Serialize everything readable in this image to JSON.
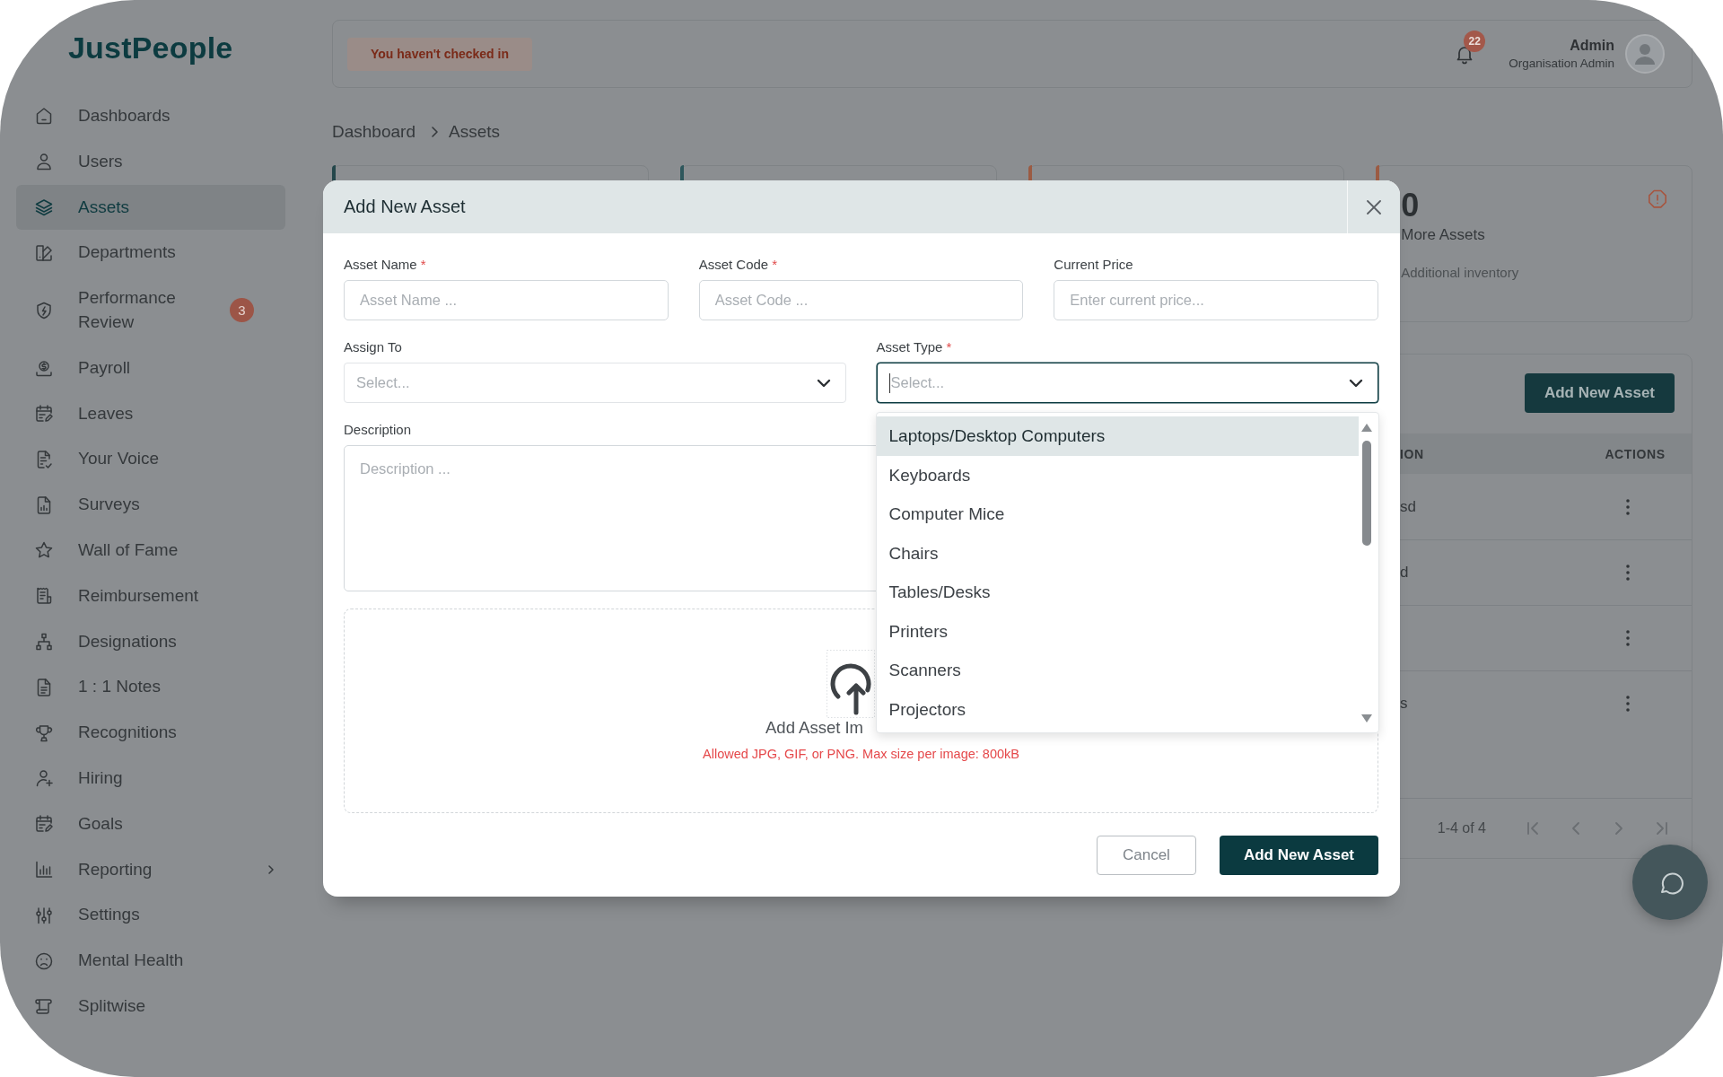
{
  "sidebar": {
    "logo": "JustPeople",
    "items": [
      {
        "label": "Dashboards",
        "kind": "link",
        "selected": false
      },
      {
        "label": "Users",
        "kind": "link",
        "selected": false
      },
      {
        "label": "Assets",
        "kind": "link",
        "selected": true
      },
      {
        "label": "Departments",
        "kind": "link",
        "selected": false
      },
      {
        "label": "Performance Review",
        "kind": "link",
        "selected": false,
        "badge": "3"
      },
      {
        "label": "Payroll",
        "kind": "link",
        "selected": false
      },
      {
        "label": "Leaves",
        "kind": "link",
        "selected": false
      },
      {
        "label": "Your Voice",
        "kind": "link",
        "selected": false
      },
      {
        "label": "Surveys",
        "kind": "link",
        "selected": false
      },
      {
        "label": "Wall of Fame",
        "kind": "link",
        "selected": false
      },
      {
        "label": "Reimbursement",
        "kind": "link",
        "selected": false
      },
      {
        "label": "Designations",
        "kind": "link",
        "selected": false
      },
      {
        "label": "1 : 1 Notes",
        "kind": "link",
        "selected": false
      },
      {
        "label": "Recognitions",
        "kind": "link",
        "selected": false
      },
      {
        "label": "Hiring",
        "kind": "link",
        "selected": false
      },
      {
        "label": "Goals",
        "kind": "link",
        "selected": false
      },
      {
        "label": "Reporting",
        "kind": "group",
        "selected": false,
        "expanded": false
      },
      {
        "label": "Settings",
        "kind": "link",
        "selected": false
      },
      {
        "label": "Mental Health",
        "kind": "link",
        "selected": false
      },
      {
        "label": "Splitwise",
        "kind": "link",
        "selected": false
      }
    ]
  },
  "header": {
    "checkin_status": "You haven't checked in",
    "notifications": {
      "count": "22"
    },
    "user": {
      "name": "Admin",
      "role": "Organisation Admin"
    }
  },
  "breadcrumb": [
    {
      "label": "Dashboard"
    },
    {
      "label": "Assets"
    }
  ],
  "stat_cards": [
    {
      "color": "#24474b"
    },
    {
      "color": "#2e575c"
    },
    {
      "color": "#9b5b43"
    },
    {
      "color": "#9b5b43",
      "value": "0",
      "label": "More Assets",
      "note": "Additional inventory"
    }
  ],
  "assets_table": {
    "add_button": "Add New Asset",
    "columns": [
      {
        "label": "ION"
      },
      {
        "label": "ACTIONS"
      }
    ],
    "rows": [
      {
        "column_1": "sd"
      },
      {
        "column_1": "d"
      },
      {},
      {
        "column_1": "s"
      }
    ],
    "pagination": {
      "range": "1-4 of 4"
    }
  },
  "modal": {
    "title": "Add New Asset",
    "field_rows": [
      [
        {
          "label": "Asset Name",
          "required_mark": "*",
          "kind": "text",
          "placeholder": "Asset Name ..."
        },
        {
          "label": "Asset Code",
          "required_mark": "*",
          "kind": "text",
          "placeholder": "Asset Code ..."
        },
        {
          "label": "Current Price",
          "kind": "text",
          "placeholder": "Enter current price..."
        }
      ],
      [
        {
          "label": "Assign To",
          "kind": "select",
          "placeholder": "Select...",
          "open": false
        },
        {
          "label": "Asset Type",
          "required_mark": "*",
          "kind": "select",
          "placeholder": "Select...",
          "open": true,
          "options": [
            {
              "label": "Laptops/Desktop Computers",
              "selected": true
            },
            {
              "label": "Keyboards",
              "selected": false
            },
            {
              "label": "Computer Mice",
              "selected": false
            },
            {
              "label": "Chairs",
              "selected": false
            },
            {
              "label": "Tables/Desks",
              "selected": false
            },
            {
              "label": "Printers",
              "selected": false
            },
            {
              "label": "Scanners",
              "selected": false
            },
            {
              "label": "Projectors",
              "selected": false
            }
          ]
        }
      ],
      [
        {
          "label": "Description",
          "kind": "textarea",
          "placeholder": "Description ..."
        }
      ]
    ],
    "upload": {
      "title": "Add Asset Im",
      "hint": "Allowed JPG, GIF, or PNG. Max size per image: 800kB"
    },
    "buttons": [
      {
        "label": "Cancel",
        "kind": "secondary"
      },
      {
        "label": "Add New Asset",
        "kind": "primary"
      }
    ]
  }
}
